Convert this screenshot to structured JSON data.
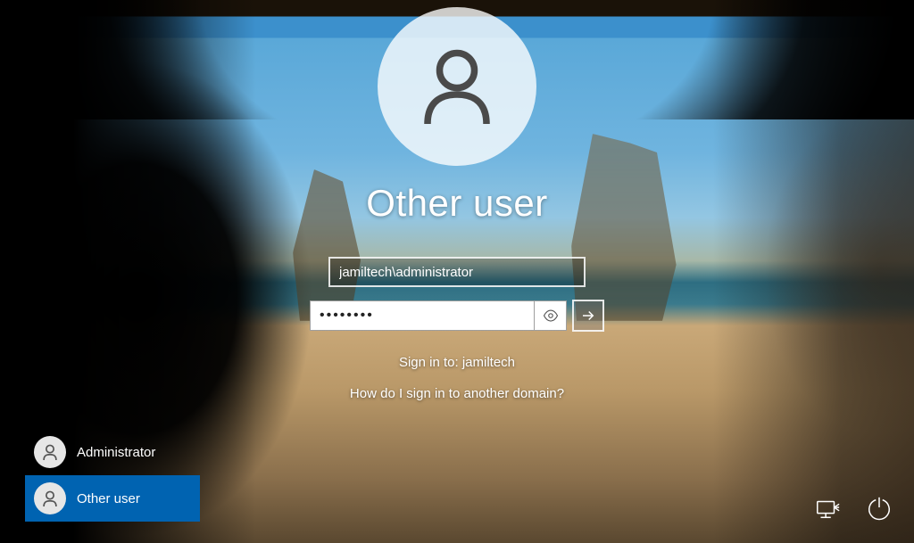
{
  "heading": "Other user",
  "username_value": "jamiltech\\administrator",
  "password_value": "••••••••",
  "sign_in_to": "Sign in to: jamiltech",
  "domain_help": "How do I sign in to another domain?",
  "users": [
    {
      "label": "Administrator",
      "selected": false
    },
    {
      "label": "Other user",
      "selected": true
    }
  ],
  "bottom_icons": {
    "ease_of_access": "ease-of-access-icon",
    "power": "power-icon"
  }
}
